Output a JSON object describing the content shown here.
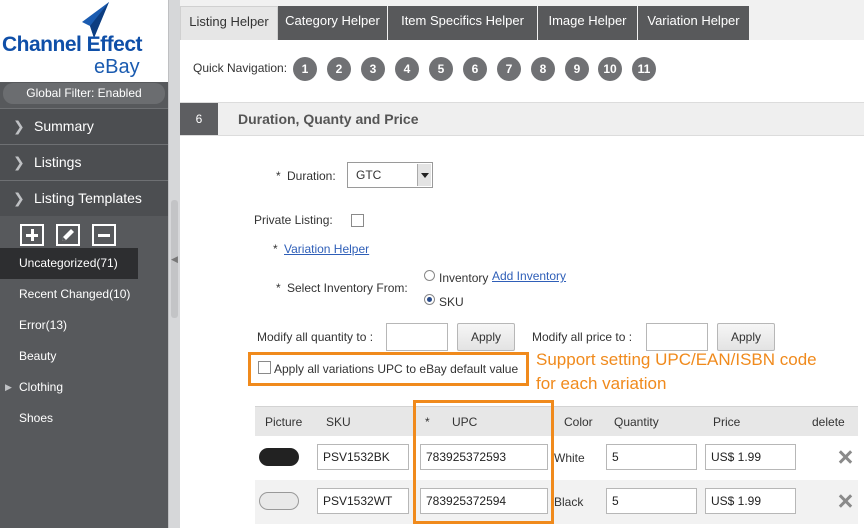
{
  "app": {
    "logo_line1": "Channel Effect",
    "logo_line2": "eBay",
    "brand_color": "#0f4fa8"
  },
  "sidebar": {
    "global_filter": "Global Filter: Enabled",
    "nav": [
      {
        "label": "Summary",
        "icon": "chevron-right-icon"
      },
      {
        "label": "Listings",
        "icon": "chevron-right-icon"
      },
      {
        "label": "Listing Templates",
        "icon": "chevron-right-icon"
      }
    ],
    "tools": [
      "add-icon",
      "edit-pencil-icon",
      "remove-icon"
    ],
    "categories": [
      {
        "label": "Uncategorized(71)",
        "active": true
      },
      {
        "label": "Recent Changed(10)"
      },
      {
        "label": "Error(13)"
      },
      {
        "label": "Beauty"
      },
      {
        "label": "Clothing",
        "expandable": true
      },
      {
        "label": "Shoes"
      }
    ]
  },
  "tabs": [
    "Listing Helper",
    "Category Helper",
    "Item Specifics Helper",
    "Image Helper",
    "Variation Helper"
  ],
  "active_tab": "Listing Helper",
  "quick_nav": {
    "label": "Quick Navigation:",
    "items": [
      "1",
      "2",
      "3",
      "4",
      "5",
      "6",
      "7",
      "8",
      "9",
      "10",
      "11"
    ]
  },
  "section": {
    "number": "6",
    "title": "Duration, Quanty and Price"
  },
  "form": {
    "required_mark": "*",
    "duration_label": "Duration:",
    "duration_value": "GTC",
    "private_label": "Private Listing:",
    "variation_helper_link": "Variation Helper",
    "inventory_label": "Select Inventory From:",
    "inventory_option_label": "Inventory",
    "add_inventory_link": "Add Inventory",
    "sku_option_label": "SKU",
    "selected_source": "SKU",
    "modify_qty_label": "Modify all quantity to :",
    "modify_price_label": "Modify all price to :",
    "apply_label": "Apply",
    "upc_checkbox_label": "Apply all variations UPC to eBay default value"
  },
  "annotation": {
    "line1": "Support setting UPC/EAN/ISBN code",
    "line2": "for each variation",
    "color": "#f08a1c"
  },
  "table": {
    "headers": {
      "picture": "Picture",
      "sku": "SKU",
      "upc_mark": "*",
      "upc": "UPC",
      "color": "Color",
      "quantity": "Quantity",
      "price": "Price",
      "delete": "delete"
    },
    "rows": [
      {
        "sku": "PSV1532BK",
        "upc": "783925372593",
        "color": "White",
        "quantity": "5",
        "price": "US$ 1.99",
        "thumb_color": "#222222"
      },
      {
        "sku": "PSV1532WT",
        "upc": "783925372594",
        "color": "Black",
        "quantity": "5",
        "price": "US$ 1.99",
        "thumb_color": "#e9e9e9"
      }
    ]
  }
}
